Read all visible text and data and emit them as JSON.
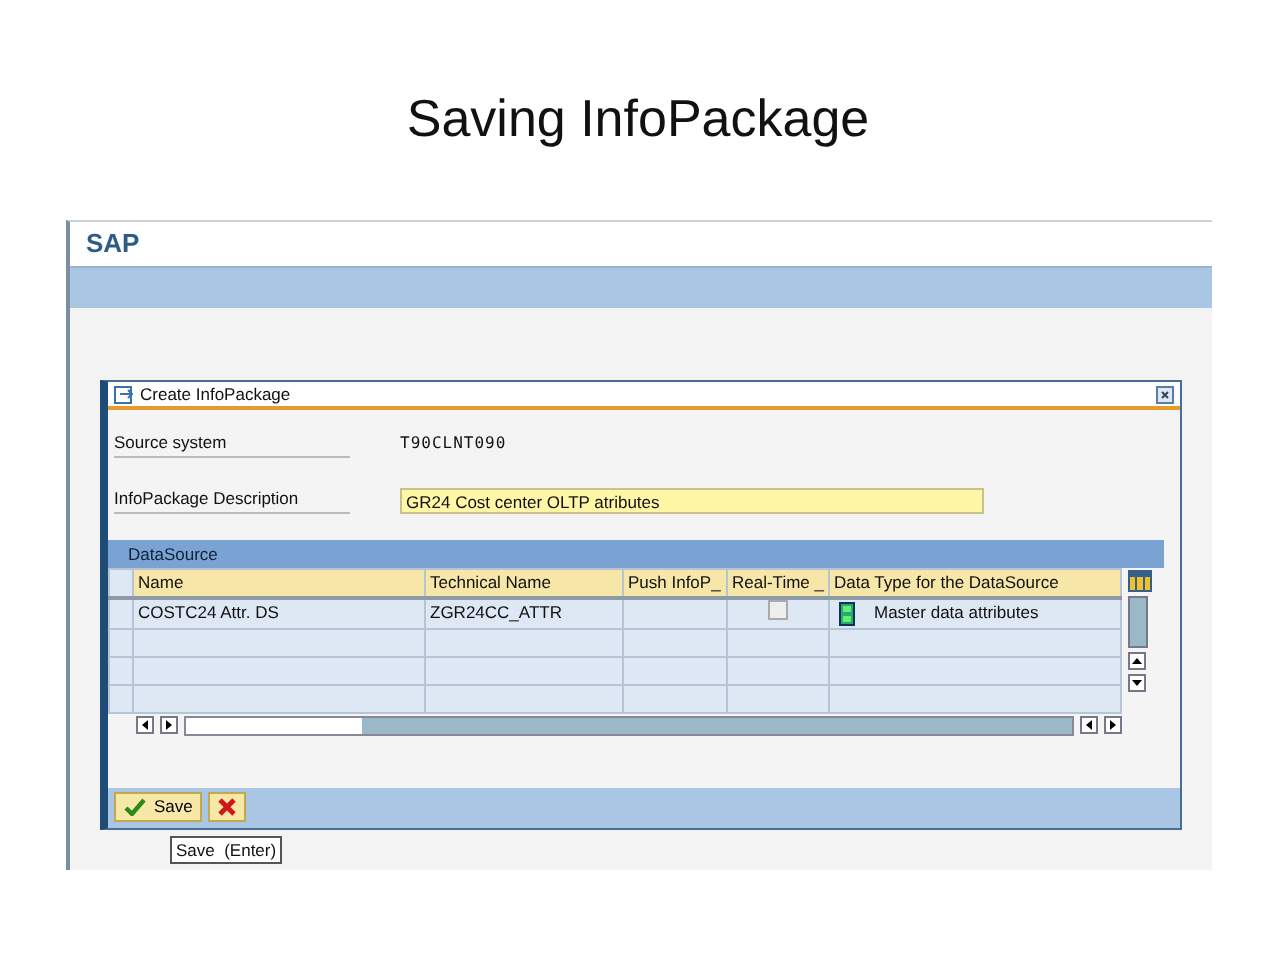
{
  "slide_title": "Saving InfoPackage",
  "app": {
    "logo": "SAP"
  },
  "dialog": {
    "title": "Create InfoPackage",
    "fields": [
      {
        "label": "Source system",
        "value": "T90CLNT090",
        "kind": "display"
      },
      {
        "label": "InfoPackage Description",
        "value": "GR24 Cost center OLTP atributes",
        "kind": "input"
      }
    ],
    "table": {
      "title": "DataSource",
      "columns": [
        "Name",
        "Technical Name",
        "Push InfoP_",
        "Real-Time _",
        "Data Type for the DataSource"
      ],
      "rows": [
        {
          "name": "COSTC24 Attr. DS",
          "technical_name": "ZGR24CC_ATTR",
          "real_time": false,
          "data_type": "Master data attributes"
        }
      ]
    },
    "buttons": [
      {
        "kind": "save",
        "label": "Save"
      },
      {
        "kind": "cancel"
      }
    ],
    "tooltip": "Save  (Enter)"
  }
}
